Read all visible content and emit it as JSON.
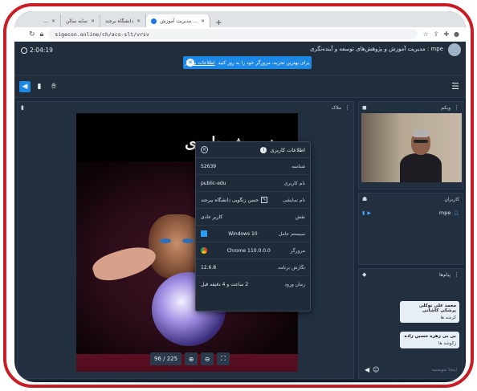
{
  "browser": {
    "tabs": [
      {
        "label": "…",
        "active": false
      },
      {
        "label": "سایه سالن",
        "active": false
      },
      {
        "label": "دانشگاه برجند",
        "active": false
      },
      {
        "label": "مدیریت آموزش …",
        "active": true
      }
    ],
    "url": "sigecon.online/ch/acs-slt/vrsv"
  },
  "header": {
    "timer": "2:04:19",
    "meeting_title": "mpe : مدیریت آموزش و پژوهش‌های توسعه و آینده‌نگری",
    "notice_text": "برای بهترین تجربه، مرورگر خود را به روز کنید",
    "notice_link": "اطلاعات بیشتر"
  },
  "panels": {
    "presentation_title": "ملاک",
    "webcam_title": "وبکم",
    "participants_title": "کاربران",
    "chat_title": "پیام‌ها"
  },
  "slide": {
    "title": "نه پیش داوری",
    "page_counter": "96 / 225"
  },
  "user_info": {
    "title": "اطلاعات کاربری",
    "rows": [
      {
        "label": "شناسه",
        "value": "52639"
      },
      {
        "label": "نام کاربری",
        "value": "public-edu"
      },
      {
        "label": "نام نمایشی",
        "value": "حسن زنگویی دانشگاه بیرجند"
      },
      {
        "label": "نقش",
        "value": "کاربر عادی"
      },
      {
        "label": "سیستم عامل",
        "value": "Windows 10"
      },
      {
        "label": "مرورگر",
        "value": "Chrome 110.0.0.0"
      },
      {
        "label": "نگارش برنامه",
        "value": "12.6.8"
      },
      {
        "label": "زمان ورود",
        "value": "2 ساعت و 4 دقیقه قبل"
      }
    ]
  },
  "participants": [
    {
      "name": "mpe"
    }
  ],
  "chat": {
    "messages": [
      {
        "name": "محمد علی توکلی پرشکی کاشانی",
        "text": "کرشه ها"
      },
      {
        "name": "بی بی زهره حسین زاده",
        "text": "زکوشه ها"
      }
    ],
    "placeholder": "اینجا بنویسید"
  },
  "colors": {
    "frame": "#c81d25",
    "app_bg": "#1b2838",
    "accent": "#1e88e5"
  }
}
